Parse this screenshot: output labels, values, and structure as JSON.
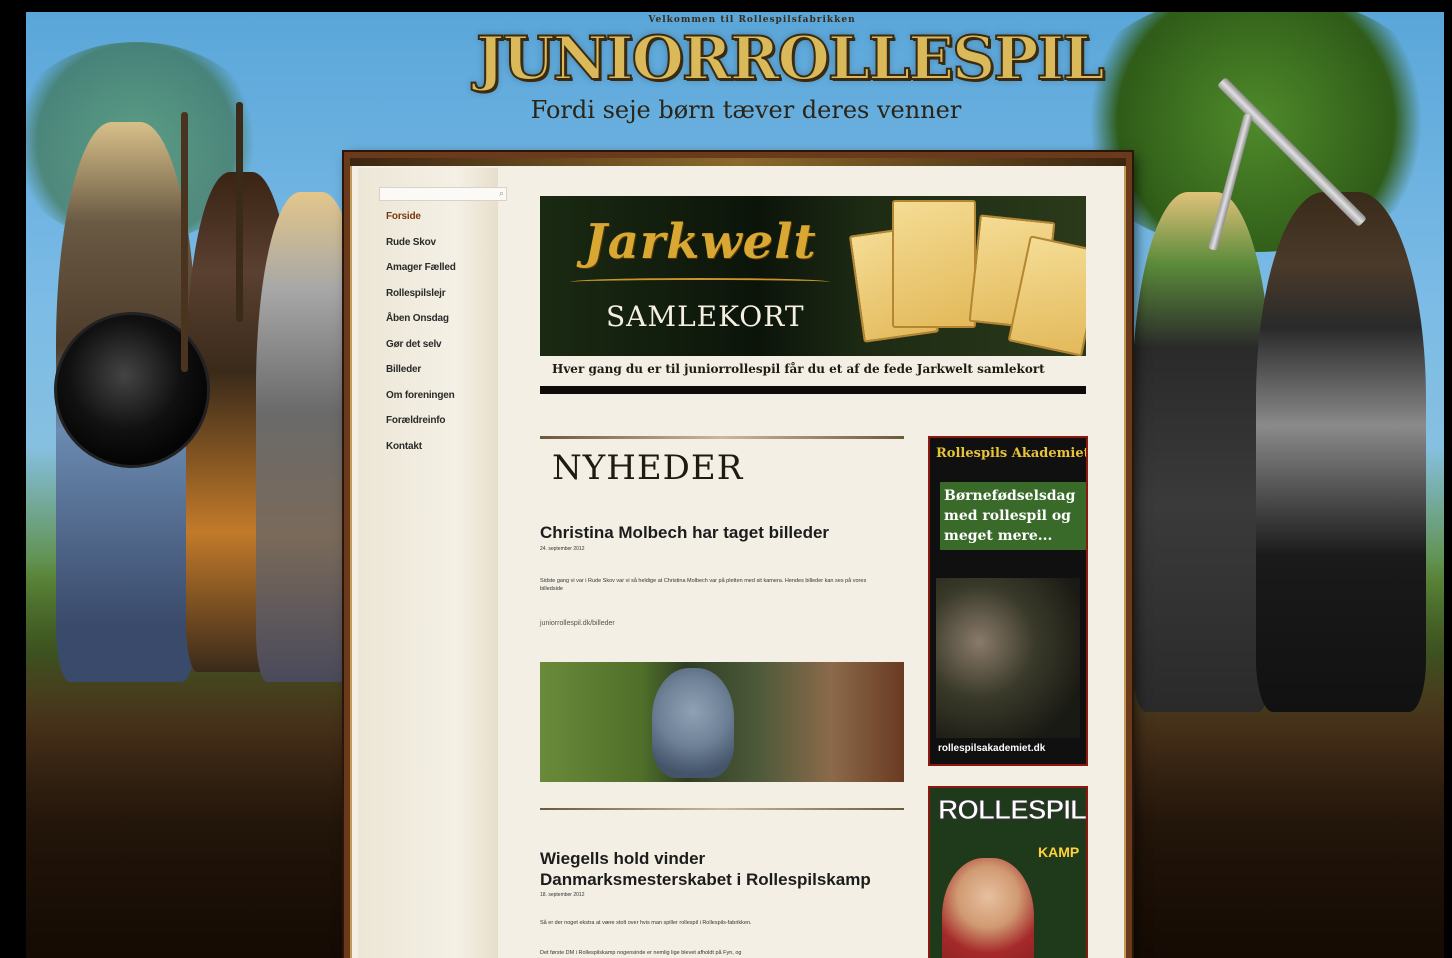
{
  "header": {
    "welcome": "Velkommen til Rollespilsfabrikken",
    "logo": "JUNIORROLLESPIL",
    "tagline": "Fordi seje børn tæver deres venner"
  },
  "search": {
    "placeholder": ""
  },
  "nav": [
    {
      "label": "Forside",
      "active": true
    },
    {
      "label": "Rude Skov"
    },
    {
      "label": "Amager Fælled"
    },
    {
      "label": "Rollespilslejr"
    },
    {
      "label": "Åben Onsdag"
    },
    {
      "label": "Gør det selv"
    },
    {
      "label": "Billeder"
    },
    {
      "label": "Om foreningen"
    },
    {
      "label": "Forældreinfo"
    },
    {
      "label": "Kontakt"
    }
  ],
  "banner": {
    "title": "Jarkwelt",
    "subtitle": "SAMLEKORT",
    "caption": "Hver gang du er til juniorrollespil får du et af de fede Jarkwelt samlekort"
  },
  "news": {
    "heading": "NYHEDER",
    "posts": [
      {
        "title": "Christina Molbech har taget billeder",
        "date": "24. september 2012",
        "text": "Sidste gang vi var i Rude Skov var vi så heldige at Christina Molbech var på pletten med sit kamera. Hendes billeder kan ses på vores billedside",
        "link": "juniorrollespil.dk/billeder"
      },
      {
        "title": "Wiegells hold vinder Danmarksmesterskabet i Rollespilskamp",
        "date": "18. september 2012",
        "text1": "Så er der noget ekstra at være stolt over hvis man spiller rollespil i Rollespils-fabrikken.",
        "text2": "Det første DM i Rollespilskamp nogensinde er nemlig lige blevet afholdt på Fyn, og"
      }
    ]
  },
  "ads": {
    "akademiet": {
      "title": "Rollespils Akademiet",
      "body": "Børnefødselsdag med rollespil og meget mere...",
      "url": "rollespilsakademiet.dk"
    },
    "magazine": {
      "title": "ROLLESPIL",
      "kamp": "KAMP"
    }
  }
}
